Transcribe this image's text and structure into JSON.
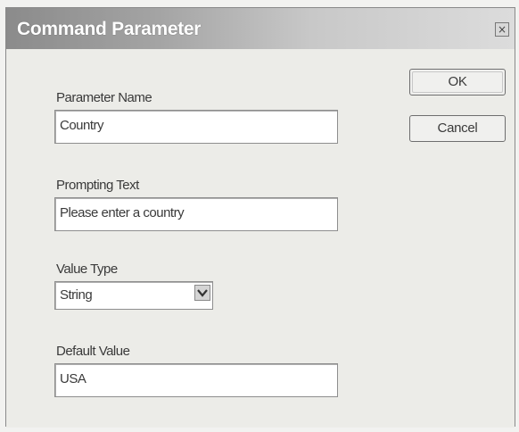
{
  "window": {
    "title": "Command Parameter",
    "close_glyph": "×"
  },
  "buttons": {
    "ok": "OK",
    "cancel": "Cancel"
  },
  "fields": {
    "parameter_name": {
      "label": "Parameter Name",
      "value": "Country"
    },
    "prompting_text": {
      "label": "Prompting Text",
      "value": "Please enter a country"
    },
    "value_type": {
      "label": "Value Type",
      "value": "String"
    },
    "default_value": {
      "label": "Default Value",
      "value": "USA"
    }
  },
  "icons": {
    "close": "close-icon",
    "dropdown": "chevron-down-icon"
  },
  "colors": {
    "title_bar_start": "#8b8b8b",
    "title_bar_end": "#dcdcdc",
    "dialog_background": "#ecece8",
    "text": "#3a3a3a"
  }
}
